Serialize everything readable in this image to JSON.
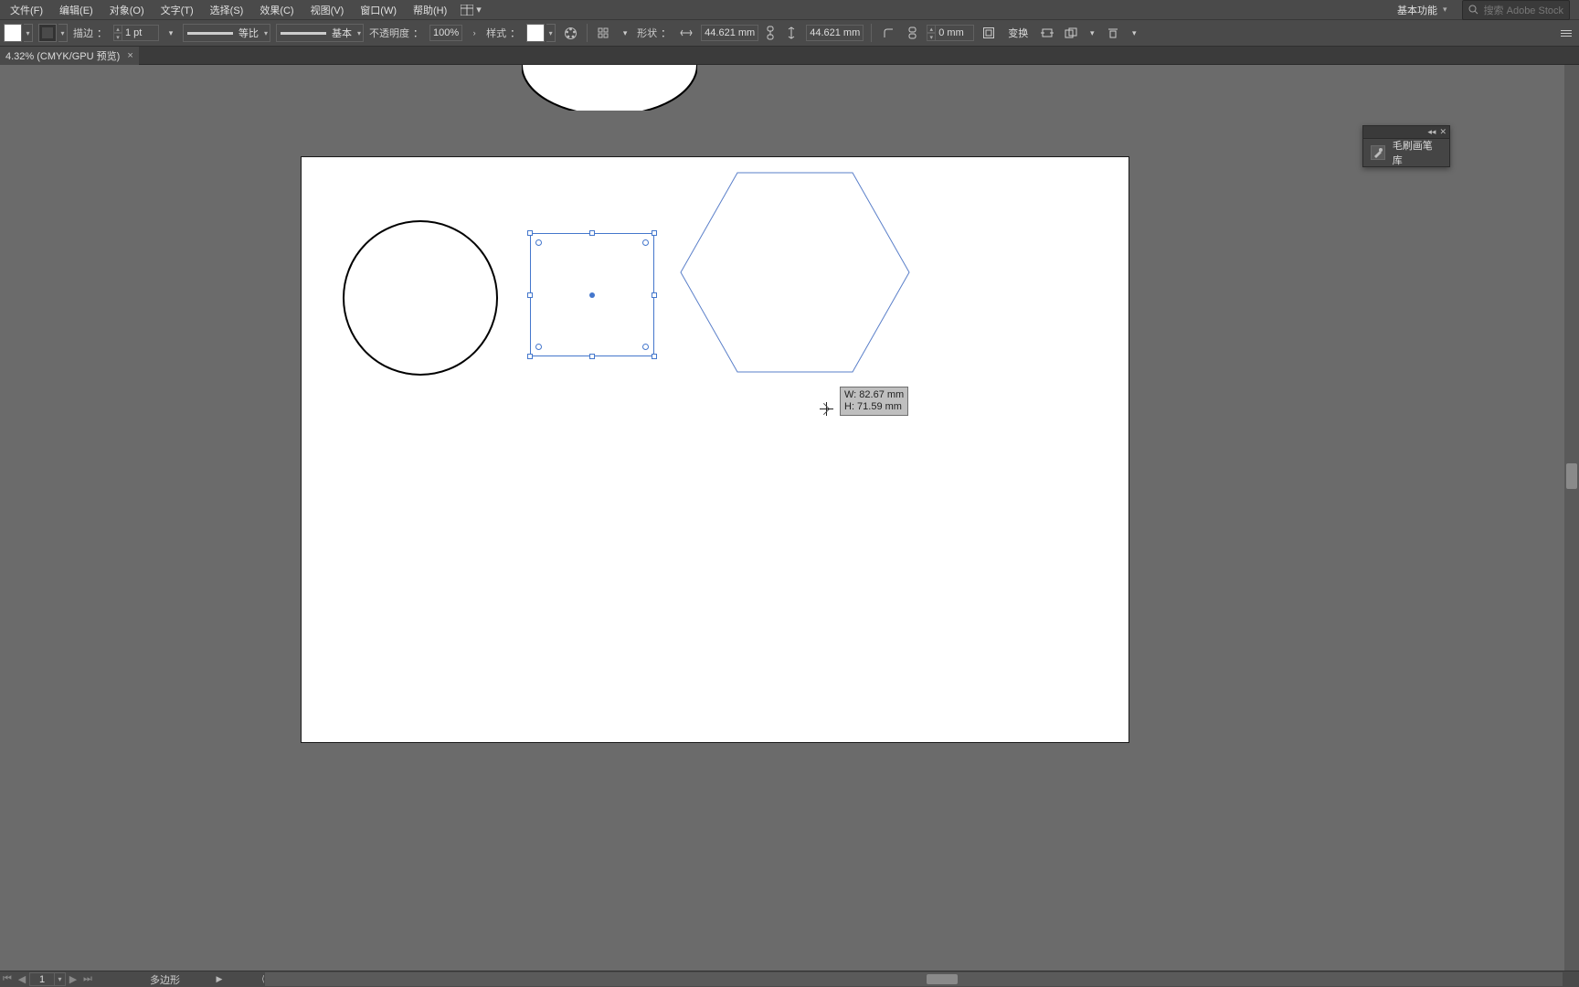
{
  "menu": {
    "items": [
      "文件(F)",
      "编辑(E)",
      "对象(O)",
      "文字(T)",
      "选择(S)",
      "效果(C)",
      "视图(V)",
      "窗口(W)",
      "帮助(H)"
    ]
  },
  "workspace_switcher": {
    "label": "基本功能"
  },
  "search": {
    "placeholder": "搜索 Adobe Stock"
  },
  "options": {
    "stroke_label": "描边",
    "stroke_weight": "1 pt",
    "profile_label": "等比",
    "brush_label": "基本",
    "opacity_label": "不透明度",
    "opacity_value": "100%",
    "style_label": "样式",
    "shape_label": "形状",
    "width_value": "44.621 mm",
    "height_value": "44.621 mm",
    "corner_value": "0 mm",
    "transform_label": "变换"
  },
  "tab": {
    "label": "4.32% (CMYK/GPU 预览)"
  },
  "panel": {
    "title": "毛刷画笔库"
  },
  "tooltip": {
    "w": "W: 82.67 mm",
    "h": "H: 71.59 mm"
  },
  "status": {
    "page": "1",
    "tool": "多边形"
  }
}
